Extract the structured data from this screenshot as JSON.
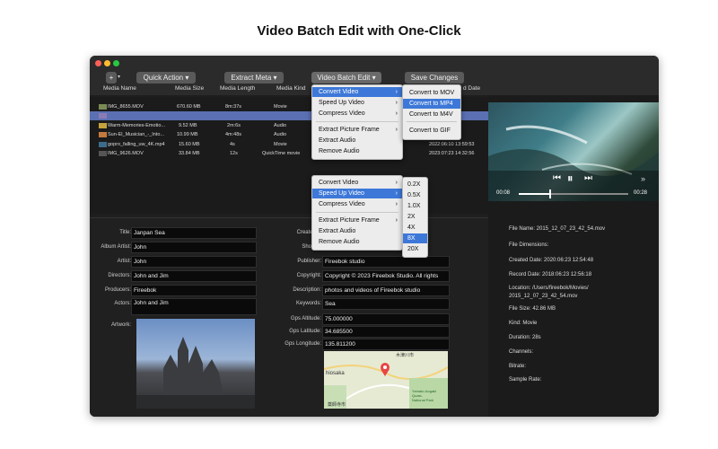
{
  "headline": "Video Batch Edit with One-Click",
  "toolbar": {
    "add_label": "+",
    "quick_action": "Quick Action",
    "extract_meta": "Extract Meta",
    "batch_edit": "Video Batch Edit",
    "save_changes": "Save Changes"
  },
  "columns": [
    "Media Name",
    "Media Size",
    "Media Length",
    "Media Kind",
    "d Date"
  ],
  "rows": [
    {
      "name": "IMG_8655.MOV",
      "size": "670.60 MB",
      "length": "8m:37s",
      "kind": "Movie",
      "date": ""
    },
    {
      "name": "",
      "size": "",
      "length": "",
      "kind": "",
      "date": ""
    },
    {
      "name": "Warm-Memories-Emotio...",
      "size": "9.52 MB",
      "length": "2m:6s",
      "kind": "Audio",
      "date": ""
    },
    {
      "name": "Sun-El_Musician_-_Into...",
      "size": "10.99 MB",
      "length": "4m:48s",
      "kind": "Audio",
      "date": ""
    },
    {
      "name": "gopro_falling_uw_4K.mp4",
      "size": "15.60 MB",
      "length": "4s",
      "kind": "Movie",
      "date": "2022:06:10 13:59:53"
    },
    {
      "name": "IMG_9626.MOV",
      "size": "33.84 MB",
      "length": "12s",
      "kind": "QuickTime movie",
      "date": "2023:07:23 14:32:56"
    }
  ],
  "menu1": {
    "items": [
      "Convert Video",
      "Speed Up Video",
      "Compress Video",
      "Extract Picture Frame",
      "Extract Audio",
      "Remove Audio"
    ],
    "sub": [
      "Convert to MOV",
      "Convert to MP4",
      "Convert to M4V",
      "Convert to GIF"
    ]
  },
  "menu2": {
    "items": [
      "Convert Video",
      "Speed Up Video",
      "Compress Video",
      "Extract Picture Frame",
      "Extract Audio",
      "Remove Audio"
    ],
    "sub": [
      "0.2X",
      "0.5X",
      "1.0X",
      "2X",
      "4X",
      "8X",
      "20X"
    ]
  },
  "left_fields": [
    {
      "label": "Title:",
      "value": "Janpan Sea"
    },
    {
      "label": "Album Artist:",
      "value": "John"
    },
    {
      "label": "Artist:",
      "value": "John"
    },
    {
      "label": "Directors:",
      "value": "John and Jim"
    },
    {
      "label": "Producers:",
      "value": "Fireebok"
    },
    {
      "label": "Actors:",
      "value": "John and Jim"
    }
  ],
  "artwork_label": "Artwork:",
  "mid_fields": [
    {
      "label": "Created D",
      "value": ""
    },
    {
      "label": "Shoot D",
      "value": ""
    },
    {
      "label": "Publisher:",
      "value": "Fireebok studio"
    },
    {
      "label": "Copyright:",
      "value": "Copyright © 2023 Fireebok Studio. All rights"
    },
    {
      "label": "Description:",
      "value": "photos and videos of Fireebok studio"
    },
    {
      "label": "Keywords:",
      "value": "Sea"
    },
    {
      "label": "Gps Altitude:",
      "value": "75.000000"
    },
    {
      "label": "Gps Latitude:",
      "value": "34.685500"
    },
    {
      "label": "Gps Longitude:",
      "value": "135.811200"
    }
  ],
  "map_labels": {
    "a": "木津川市",
    "b": "hiosaka",
    "c": "Yamato-Aogaki\nQuasi-\nNational Park",
    "d": "薬師寺市"
  },
  "player": {
    "current": "00:08",
    "total": "00:28"
  },
  "file_info": [
    "File Name: 2015_12_07_23_42_54.mov",
    "File Dimensions:",
    "Created Date: 2020:06:23 12:54:48",
    "Record Date: 2018:06:23 12:56:18",
    "Location: /Users/fireebok/Movies/",
    "2015_12_07_23_42_54.mov",
    "File Size: 42.86 MB",
    "Kind: Movie",
    "Duration: 28s",
    "Channels:",
    "Bitrate:",
    "Sample Rate:"
  ],
  "colors": {
    "accent": "#3d78d8",
    "selection": "#5b6fb3",
    "window": "#1e1e1e"
  }
}
